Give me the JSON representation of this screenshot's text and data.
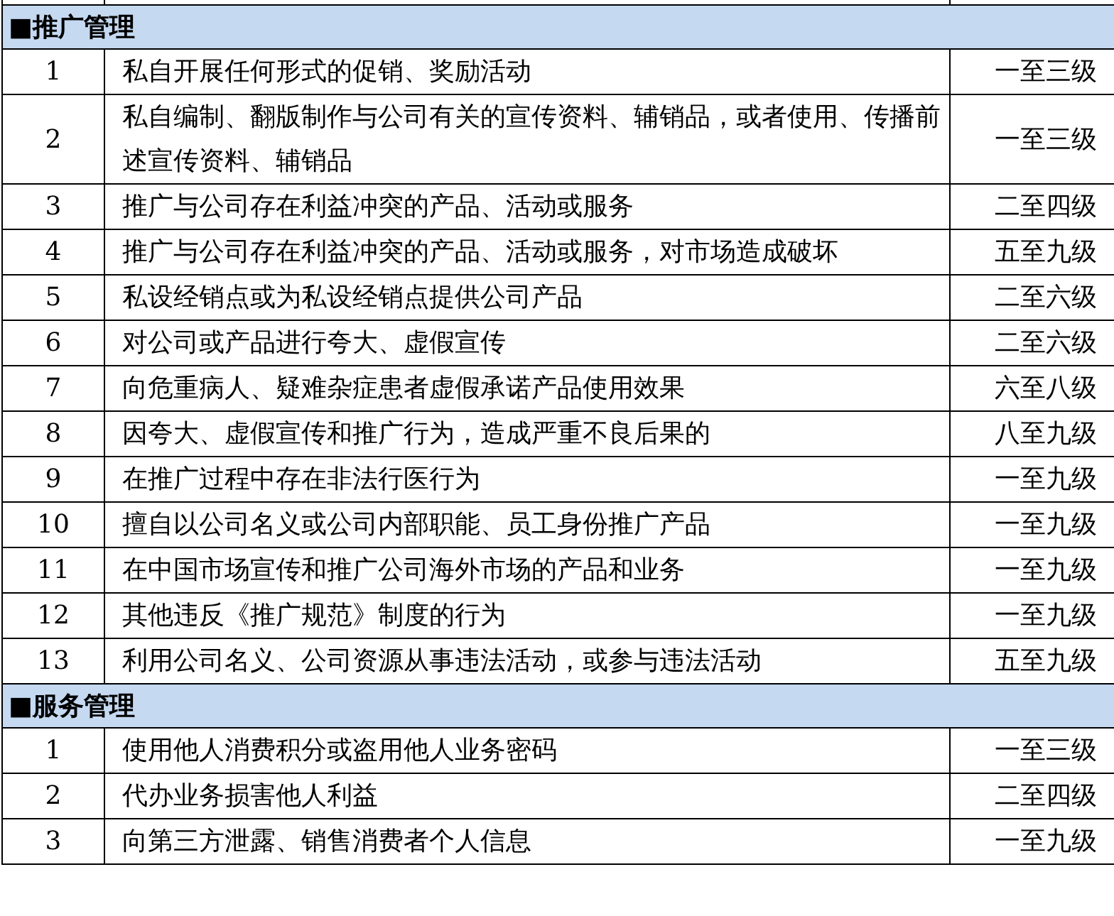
{
  "sections": [
    {
      "title": "■推广管理",
      "rows": [
        {
          "no": "1",
          "item": "私自开展任何形式的促销、奖励活动",
          "level": "一至三级"
        },
        {
          "no": "2",
          "item": "私自编制、翻版制作与公司有关的宣传资料、辅销品，或者使用、传播前述宣传资料、辅销品",
          "level": "一至三级"
        },
        {
          "no": "3",
          "item": "推广与公司存在利益冲突的产品、活动或服务",
          "level": "二至四级"
        },
        {
          "no": "4",
          "item": "推广与公司存在利益冲突的产品、活动或服务，对市场造成破坏",
          "level": "五至九级"
        },
        {
          "no": "5",
          "item": "私设经销点或为私设经销点提供公司产品",
          "level": "二至六级"
        },
        {
          "no": "6",
          "item": "对公司或产品进行夸大、虚假宣传",
          "level": "二至六级"
        },
        {
          "no": "7",
          "item": "向危重病人、疑难杂症患者虚假承诺产品使用效果",
          "level": "六至八级"
        },
        {
          "no": "8",
          "item": "因夸大、虚假宣传和推广行为，造成严重不良后果的",
          "level": "八至九级"
        },
        {
          "no": "9",
          "item": "在推广过程中存在非法行医行为",
          "level": "一至九级"
        },
        {
          "no": "10",
          "item": "擅自以公司名义或公司内部职能、员工身份推广产品",
          "level": "一至九级"
        },
        {
          "no": "11",
          "item": "在中国市场宣传和推广公司海外市场的产品和业务",
          "level": "一至九级"
        },
        {
          "no": "12",
          "item": "其他违反《推广规范》制度的行为",
          "level": "一至九级"
        },
        {
          "no": "13",
          "item": "利用公司名义、公司资源从事违法活动，或参与违法活动",
          "level": "五至九级"
        }
      ]
    },
    {
      "title": "■服务管理",
      "rows": [
        {
          "no": "1",
          "item": "使用他人消费积分或盗用他人业务密码",
          "level": "一至三级"
        },
        {
          "no": "2",
          "item": "代办业务损害他人利益",
          "level": "二至四级"
        },
        {
          "no": "3",
          "item": "向第三方泄露、销售消费者个人信息",
          "level": "一至九级"
        }
      ]
    }
  ]
}
